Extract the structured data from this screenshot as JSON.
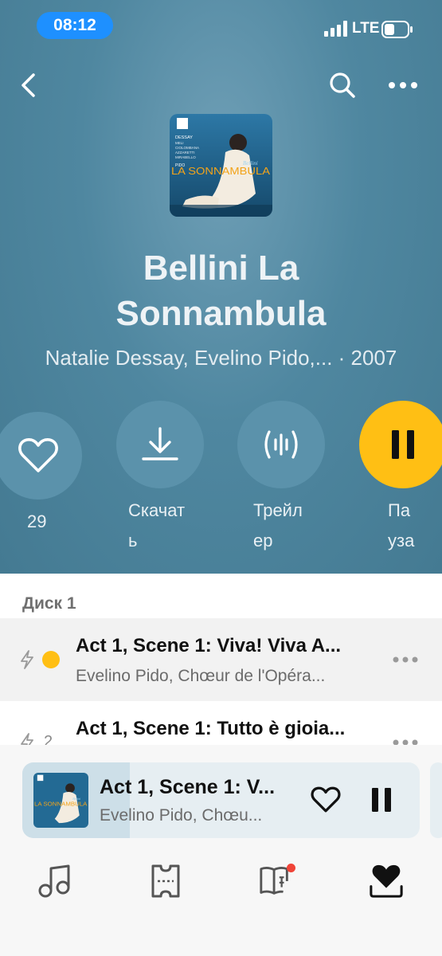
{
  "status": {
    "time": "08:12",
    "network": "LTE"
  },
  "header": {
    "back_icon": "chevron-left-icon",
    "search_icon": "search-icon",
    "more_icon": "more-horizontal-icon"
  },
  "cover": {
    "composer": "Bellini",
    "title": "LA SONNAMBULA",
    "credits": [
      "DESSAY",
      "MELI",
      "CIOLOMBANA",
      "AZZARETTI",
      "MIRABELLO",
      "PIDO"
    ],
    "colors": {
      "bg": "#1f5f86",
      "accent": "#f2a31a"
    }
  },
  "album": {
    "title_line1": "Bellini La",
    "title_line2": "Sonnambula",
    "subtitle": "Natalie Dessay, Evelino Pido,... · 2007"
  },
  "actions": {
    "like_count": "29",
    "download_line1": "Скачат",
    "download_line2": "ь",
    "trailer_line1": "Трейл",
    "trailer_line2": "ер",
    "pause_line1": "Па",
    "pause_line2": "уза"
  },
  "disc_label": "Диск 1",
  "tracks": [
    {
      "title": "Act 1, Scene 1: Viva! Viva A...",
      "artist": "Evelino Pido, Chœur de l'Opéra...",
      "status": "playing"
    },
    {
      "number": "2",
      "title": "Act 1, Scene 1: Tutto è gioia..."
    }
  ],
  "mini_player": {
    "title": "Act 1, Scene 1: V...",
    "artist": "Evelino Pido, Chœu...",
    "progress": 0.27
  },
  "tabs": [
    "music-note-icon",
    "ticket-icon",
    "book-icon",
    "collection-heart-icon"
  ],
  "colors": {
    "header_bg": "#4f87a0",
    "pause_yellow": "#ffbf14",
    "status_blue": "#1e90ff",
    "notify_red": "#f04438"
  }
}
